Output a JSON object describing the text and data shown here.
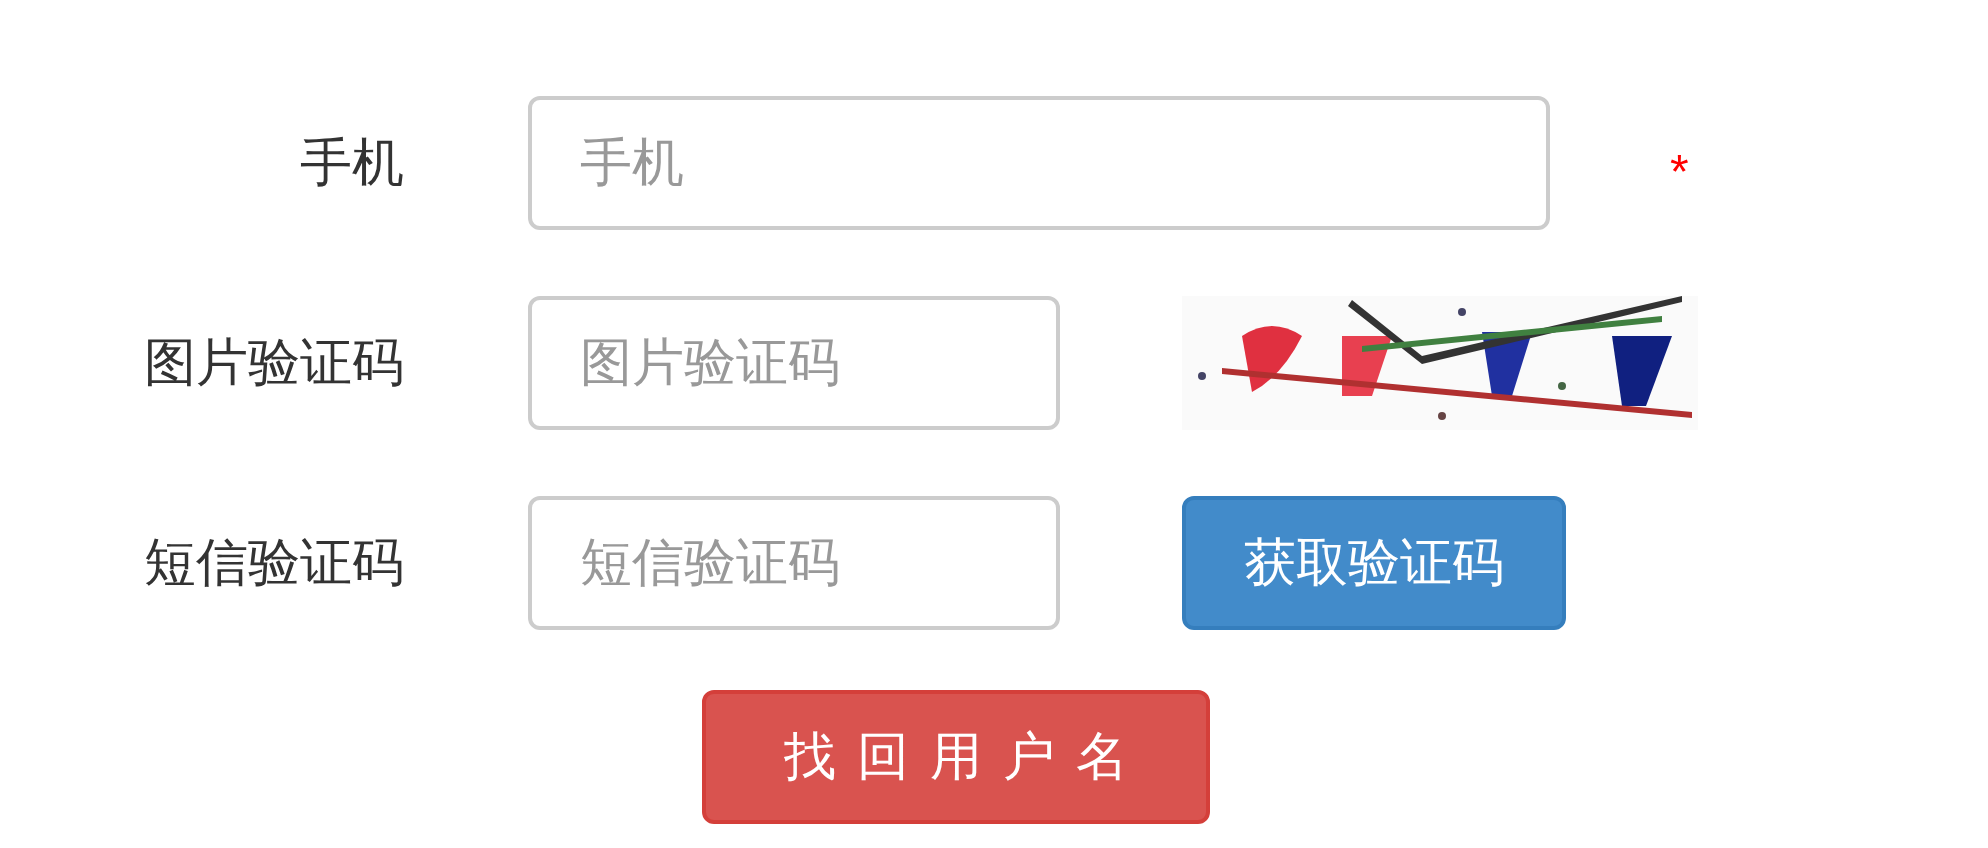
{
  "rows": [
    {
      "kind": "wide",
      "label": "手机",
      "placeholder": "手机",
      "required_mark": "*"
    },
    {
      "kind": "captcha",
      "label": "图片验证码",
      "placeholder": "图片验证码"
    },
    {
      "kind": "sms",
      "label": "短信验证码",
      "placeholder": "短信验证码",
      "button": "获取验证码"
    }
  ],
  "submit": "找回用户名"
}
